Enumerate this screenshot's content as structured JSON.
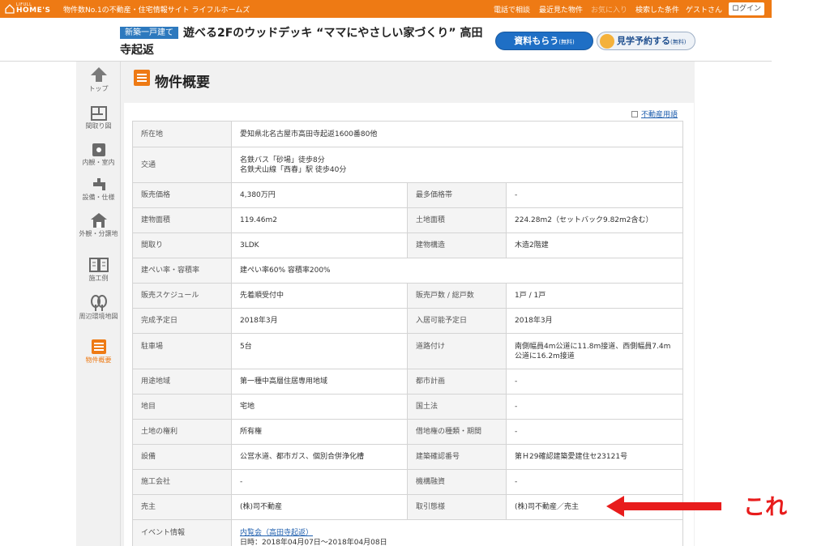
{
  "topbar": {
    "logo_small": "LIFULL",
    "logo_main": "HOME'S",
    "tagline": "物件数No.1の不動産・住宅情報サイト ライフルホームズ",
    "links": [
      "電話で相談",
      "最近見た物件",
      "お気に入り",
      "検索した条件",
      "ゲストさん"
    ],
    "login": "ログイン"
  },
  "header": {
    "badge": "新築一戸建て",
    "title_line1": "遊べる2Fのウッドデッキ “ママにやさしい家づくり” 高田",
    "title_line2": "寺起返",
    "btn_request": "資料もらう",
    "btn_request_note": "(無料)",
    "btn_visit": "見学予約する",
    "btn_visit_note": "(無料)"
  },
  "sidenav": [
    {
      "label": "トップ",
      "icon": "arrow-up-icon"
    },
    {
      "label": "間取り図",
      "icon": "floorplan-icon"
    },
    {
      "label": "内観・室内",
      "icon": "camera-icon"
    },
    {
      "label": "設備・仕様",
      "icon": "faucet-icon"
    },
    {
      "label": "外観・分譲地",
      "icon": "house-icon"
    },
    {
      "label": "施工例",
      "icon": "book-icon"
    },
    {
      "label": "周辺環境地図",
      "icon": "tree-icon"
    },
    {
      "label": "物件概要",
      "icon": "list-icon",
      "active": true
    }
  ],
  "section": {
    "title": "物件概要",
    "glossary": "不動産用語"
  },
  "spec": {
    "address_k": "所在地",
    "address_v": "愛知県北名古屋市高田寺起返1600番80他",
    "traffic_k": "交通",
    "traffic_v1": "名鉄バス「砂場」徒歩8分",
    "traffic_v2": "名鉄犬山線「西春」駅 徒歩40分",
    "price_k": "販売価格",
    "price_v": "4,380万円",
    "popular_k": "最多価格帯",
    "popular_v": "-",
    "building_k": "建物面積",
    "building_v": "119.46m2",
    "land_k": "土地面積",
    "land_v": "224.28m2（セットバック9.82m2含む）",
    "layout_k": "間取り",
    "layout_v": "3LDK",
    "structure_k": "建物構造",
    "structure_v": "木造2階建",
    "ratio_k": "建ぺい率・容積率",
    "ratio_v": "建ぺい率60% 容積率200%",
    "schedule_k": "販売スケジュール",
    "schedule_v": "先着順受付中",
    "units_k": "販売戸数 / 総戸数",
    "units_v": "1戸 / 1戸",
    "complete_k": "完成予定日",
    "complete_v": "2018年3月",
    "movein_k": "入居可能予定日",
    "movein_v": "2018年3月",
    "parking_k": "駐車場",
    "parking_v": "5台",
    "road_k": "道路付け",
    "road_v": "南側幅員4m公道に11.8m接道、西側幅員7.4m公道に16.2m接道",
    "zoning_k": "用途地域",
    "zoning_v": "第一種中高層住居専用地域",
    "cityplan_k": "都市計画",
    "cityplan_v": "-",
    "landcat_k": "地目",
    "landcat_v": "宅地",
    "nationalland_k": "国土法",
    "nationalland_v": "-",
    "rights_k": "土地の権利",
    "rights_v": "所有権",
    "leasehold_k": "借地権の種類・期間",
    "leasehold_v": "-",
    "facility_k": "設備",
    "facility_v": "公営水道、都市ガス、個別合併浄化槽",
    "permit_k": "建築確認番号",
    "permit_v": "第Ｈ29確認建築愛建住セ23121号",
    "builder_k": "施工会社",
    "builder_v": "-",
    "loan_k": "機構融資",
    "loan_v": "-",
    "seller_k": "売主",
    "seller_v": "(株)司不動産",
    "deal_k": "取引態様",
    "deal_v": "(株)司不動産／売主",
    "event_k": "イベント情報",
    "event_link": "内覧会（高田寺起返）",
    "event_date": "日時：2018年04月07日～2018年04月08日"
  },
  "annotation": {
    "label": "これ",
    "color": "#e81c1c"
  },
  "colors": {
    "accent": "#ee7a14",
    "primary_button": "#1f6fc5",
    "link": "#1f5fae"
  }
}
